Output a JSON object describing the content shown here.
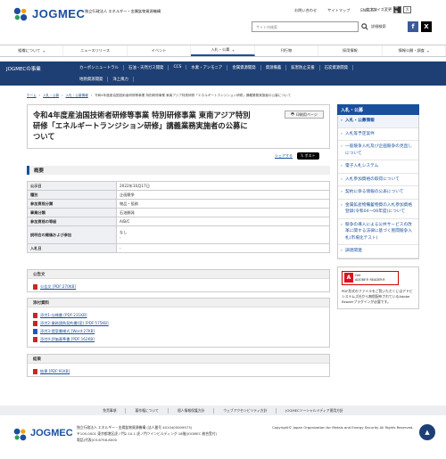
{
  "header": {
    "logo_text": "JOGMEC",
    "org_name": "独立行政法人 エネルギー・金属鉱物資源機構",
    "top_links": [
      "お問い合わせ",
      "サイトマップ",
      "ENGLISH"
    ],
    "font_size_label": "文字サイズ変更",
    "font_sizes": [
      "標準",
      "大"
    ],
    "search_placeholder": "サイト内検索",
    "detail_search": "詳細検索",
    "social": {
      "facebook": "f",
      "x": "X"
    }
  },
  "gnav": [
    {
      "label": "組織について",
      "active": false
    },
    {
      "label": "ニュースリリース",
      "active": false
    },
    {
      "label": "イベント",
      "active": false
    },
    {
      "label": "入札・公募",
      "active": true
    },
    {
      "label": "刊行物",
      "active": false
    },
    {
      "label": "採用情報",
      "active": false
    },
    {
      "label": "情報公開・調査",
      "active": false
    }
  ],
  "subnav": {
    "title": "JOGMECの事業",
    "row1": [
      "カーボンニュートラル",
      "石油・天然ガス開発",
      "CCS",
      "水素・アンモニア",
      "金属資源開発",
      "資源備蓄",
      "鉱害防止支援",
      "石炭資源開発"
    ],
    "row2": [
      "地熱資源開発",
      "洋上風力"
    ]
  },
  "breadcrumb": [
    "ホーム",
    "入札・公募",
    "入札・公募情報",
    "令和4年度産油国技術者研修等事業 特別研修事業 東南アジア特別研修「エネルギートランジション研修」講義業務実施者の公募について"
  ],
  "page": {
    "title": "令和4年度産油国技術者研修等事業 特別研修事業 東南アジア特別研修「エネルギートランジション研修」講義業務実施者の公募について",
    "print_label": "印刷用ページ",
    "share_label": "シェアする",
    "post_label": "ポスト"
  },
  "overview": {
    "heading": "概要",
    "rows": [
      {
        "label": "公示日",
        "value": "2022年10月17日"
      },
      {
        "label": "種別",
        "value": "企画競争"
      },
      {
        "label": "参加資格分類",
        "value": "物品・役務"
      },
      {
        "label": "事業分類",
        "value": "石油開発"
      },
      {
        "label": "参加資格の等級",
        "value": "A/B/C"
      },
      {
        "label": "説明会の開催および参加",
        "value": "なし"
      },
      {
        "label": "入札日",
        "value": "-"
      }
    ],
    "extra_dash": "-"
  },
  "docs": {
    "notice_head": "公告文",
    "notice": [
      {
        "label": "公告文 [PDF:270KB]",
        "type": "pdf"
      }
    ],
    "attach_head": "添付資料",
    "attach": [
      {
        "label": "添付1:仕様書 [PDF:231KB]",
        "type": "pdf"
      },
      {
        "label": "添付2:業務請負契約書(案) [PDF:575KB]",
        "type": "pdf"
      },
      {
        "label": "添付3:提案書様式 [Word:27KB]",
        "type": "word"
      },
      {
        "label": "添付4:評価基準書 [PDF:162KB]",
        "type": "pdf"
      }
    ],
    "result_head": "結果",
    "result": [
      {
        "label": "結果 [PDF:91KB]",
        "type": "pdf"
      }
    ]
  },
  "sidebar": {
    "head": "入札・公募",
    "items": [
      {
        "label": "入札・公募情報",
        "sub": true
      },
      {
        "label": "入札等予定案件",
        "sub": false
      },
      {
        "label": "一般競争入札及び企画競争の見直しについて",
        "sub": false
      },
      {
        "label": "電子入札システム",
        "sub": false
      },
      {
        "label": "入札参加資格の取得について",
        "sub": false
      },
      {
        "label": "契約に係る情報の公表について",
        "sub": false
      },
      {
        "label": "金属鉱産物備蓄物資の入札参加資格登録(令和04～06年度)について",
        "sub": false
      },
      {
        "label": "競争の導入による公共サービスの改革に関する法律に基づく民間競争入札(市場化テスト)",
        "sub": false
      },
      {
        "label": "調達関連",
        "sub": false
      }
    ],
    "adobe_get": "Get",
    "adobe_name": "ADOBE® READER®",
    "adobe_note": "PDF形式のファイルをご覧いただくにはアドビシステムズ社から無償配布されているAdobe Readerプラグインが必要です。"
  },
  "footer": {
    "links": [
      "免責事項",
      "著作権について",
      "個人情報保護方針",
      "ウェブアクセシビリティ方針",
      "JOGMECソーシャルメディア運用方針"
    ],
    "logo_text": "JOGMEC",
    "address_lines": [
      "独立行政法人 エネルギー・金属鉱物資源機構 (法人番号 4010405009573)",
      "〒105-0001 東京都港区虎ノ門2-10-1 虎ノ門ツインビルディング 16階(JOGMEC 総合受付)",
      "電話(代表)03-6758-8000"
    ],
    "copyright": "Copyright© Japan Organization for Metals and Energy Security All Rights Reserved.",
    "pagetop": "▲"
  }
}
